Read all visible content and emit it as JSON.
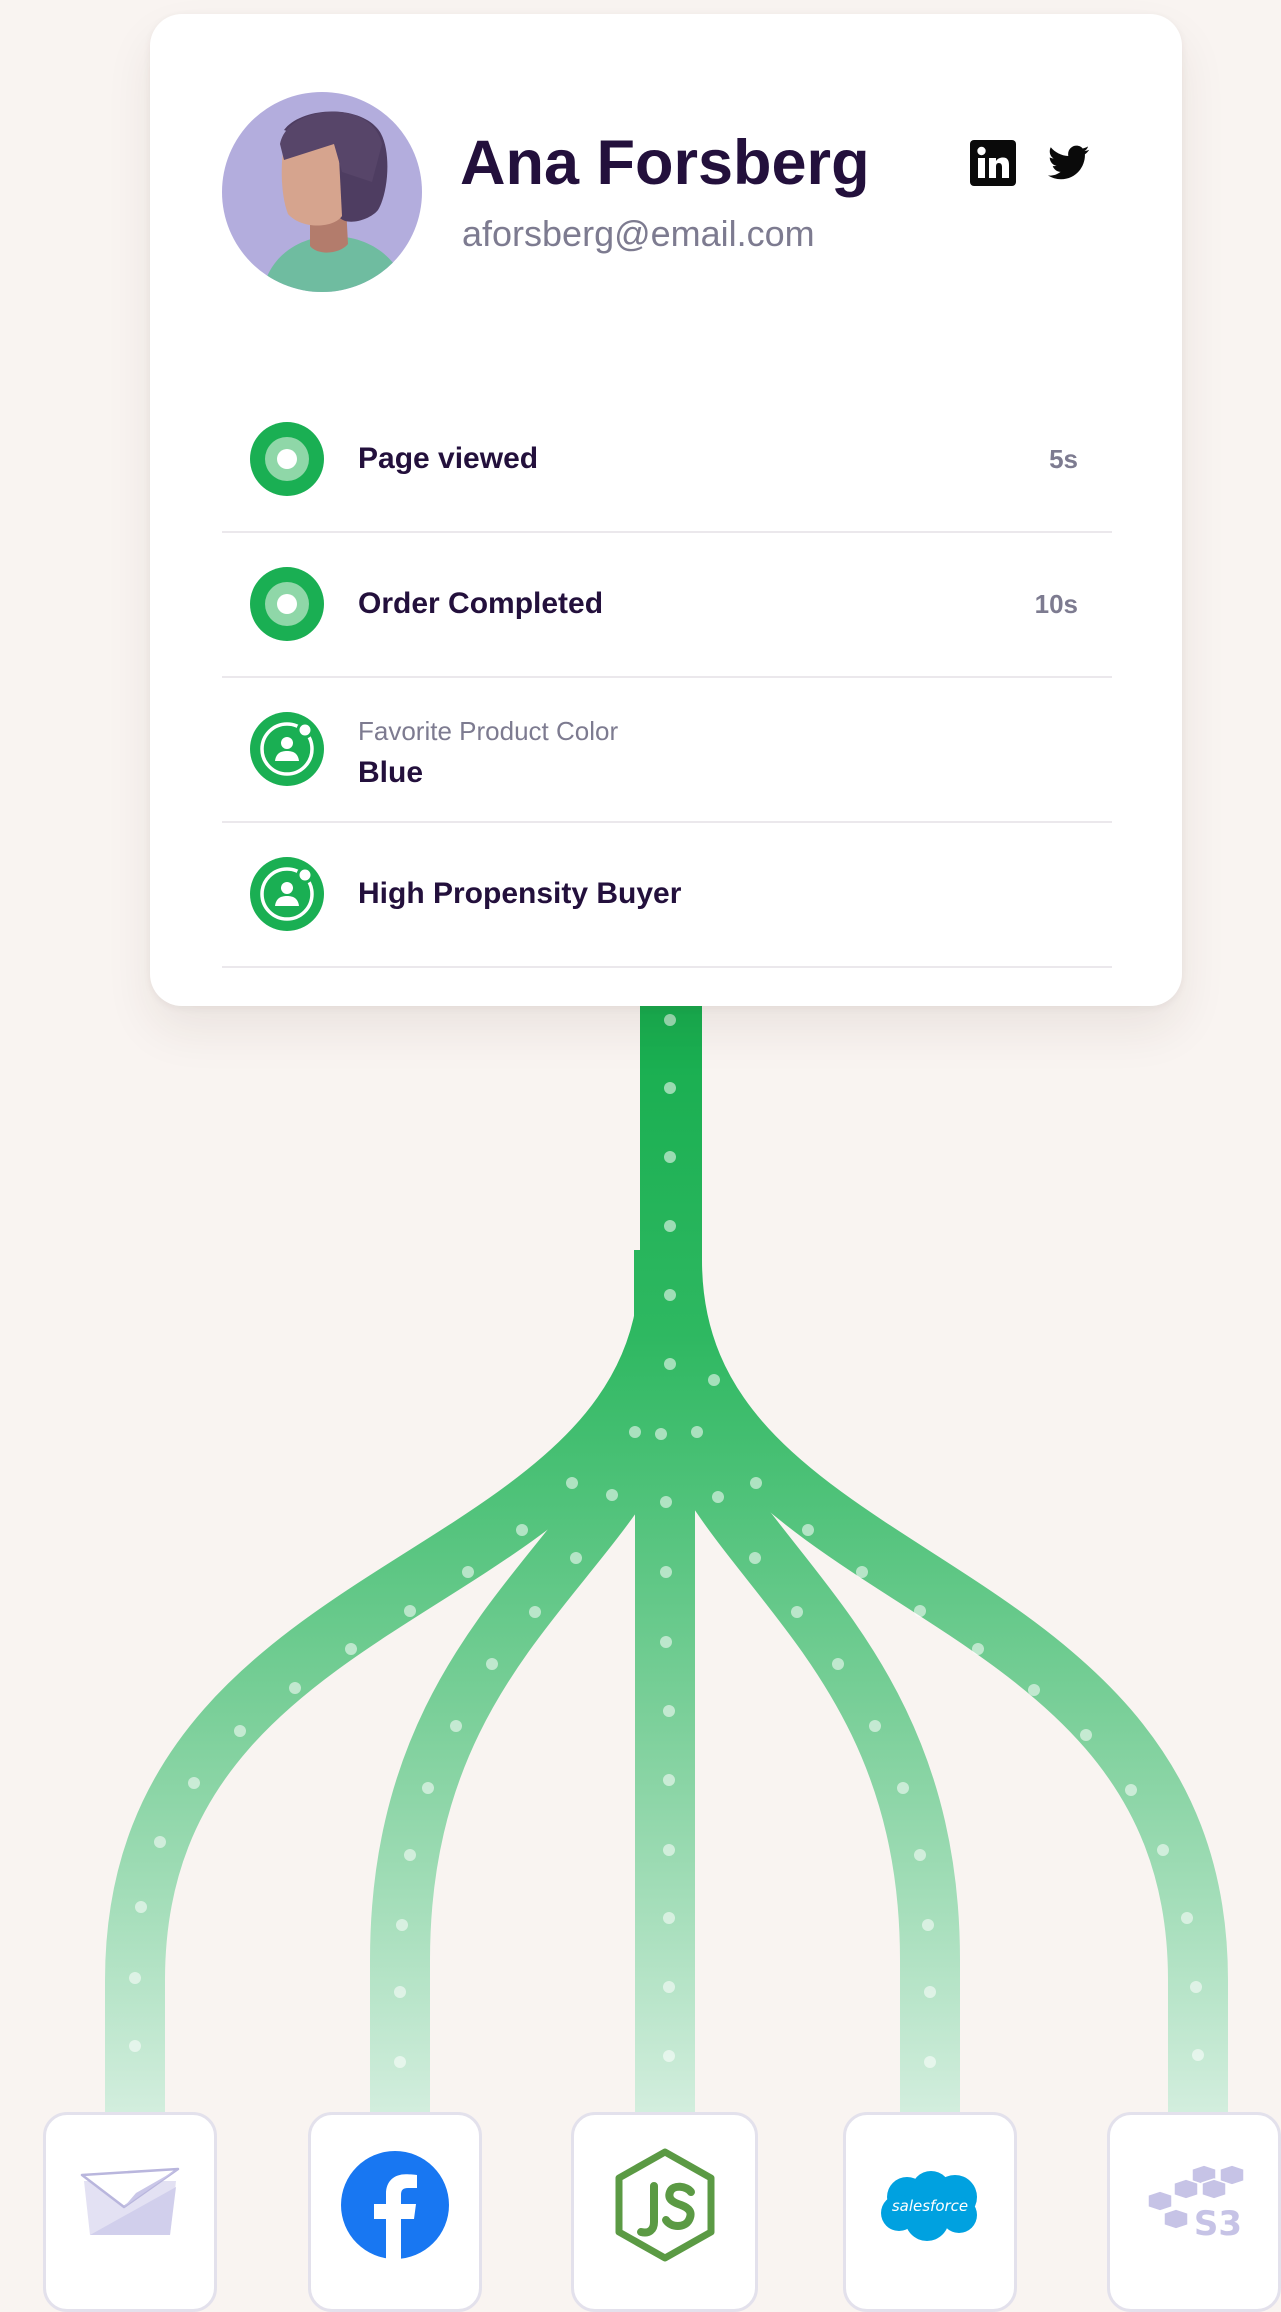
{
  "profile": {
    "name": "Ana Forsberg",
    "email": "aforsberg@email.com"
  },
  "social": [
    {
      "icon": "linkedin-icon"
    },
    {
      "icon": "twitter-icon"
    }
  ],
  "events": [
    {
      "title": "Page viewed",
      "time": "5s",
      "icon": "event-dot-icon"
    },
    {
      "title": "Order Completed",
      "time": "10s",
      "icon": "event-dot-icon"
    },
    {
      "subtitle": "Favorite Product Color",
      "value": "Blue",
      "icon": "user-trait-icon"
    },
    {
      "title": "High Propensity Buyer",
      "icon": "user-trait-icon"
    }
  ],
  "destinations": [
    {
      "icon": "email-icon"
    },
    {
      "icon": "facebook-icon"
    },
    {
      "icon": "nodejs-icon"
    },
    {
      "icon": "salesforce-icon",
      "label": "salesforce"
    },
    {
      "icon": "s3-icon",
      "label": "S3"
    }
  ],
  "colors": {
    "accent_green": "#1bb154",
    "name_text": "#23103c",
    "muted_text": "#7d7b90",
    "background": "#f9f4f1",
    "facebook_blue": "#1877f2",
    "salesforce_blue": "#00a1e0",
    "node_green": "#5b9a44"
  }
}
